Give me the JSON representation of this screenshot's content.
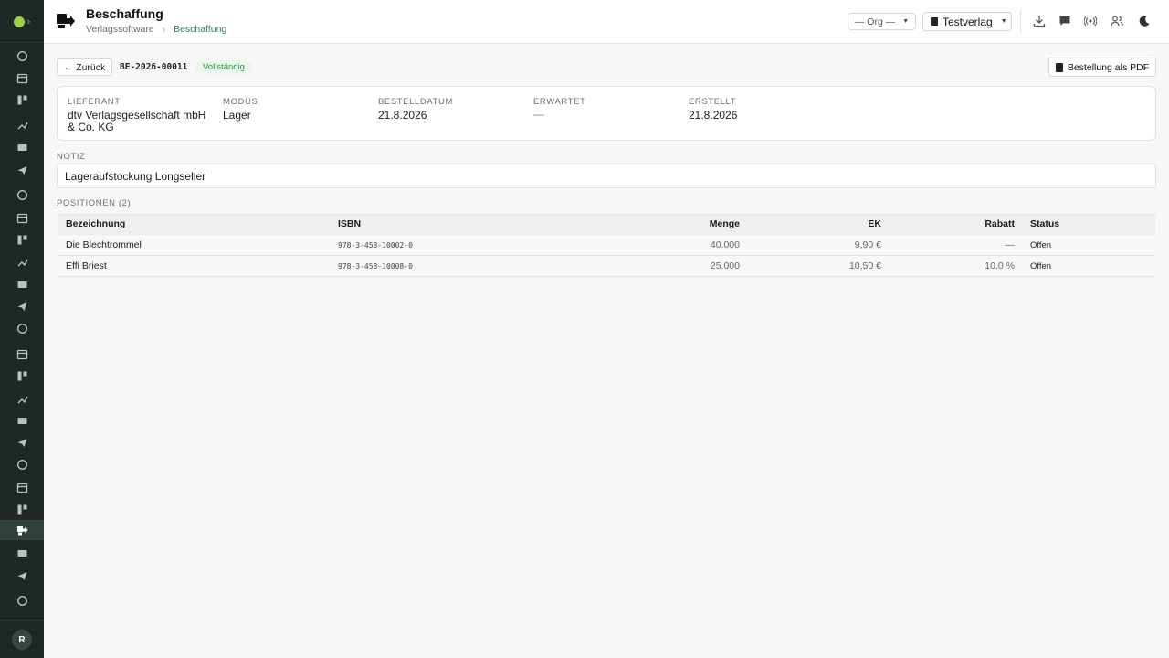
{
  "sidebar": {
    "items": [
      {
        "icon": "dashboard-icon"
      },
      {
        "icon": "calendar-icon"
      },
      {
        "icon": "kanban-icon"
      },
      {
        "icon": "authors-icon"
      },
      {
        "icon": "books-icon"
      },
      {
        "icon": "send-icon"
      },
      {
        "icon": "lightbulb-icon"
      },
      {
        "icon": "library-icon"
      },
      {
        "icon": "image-icon"
      },
      {
        "icon": "briefcase-icon"
      },
      {
        "icon": "newspaper-icon"
      },
      {
        "icon": "scroll-icon"
      },
      {
        "icon": "feather-icon"
      },
      {
        "icon": "truck-icon"
      },
      {
        "icon": "circle-icon"
      },
      {
        "icon": "shopping-bag-icon"
      },
      {
        "icon": "megaphone-icon"
      },
      {
        "icon": "video-icon"
      },
      {
        "icon": "music-icon"
      },
      {
        "icon": "file-icon"
      },
      {
        "icon": "store-icon"
      },
      {
        "icon": "procurement-icon",
        "active": true
      },
      {
        "icon": "chart-icon"
      },
      {
        "icon": "clipboard-icon"
      },
      {
        "icon": "shield-icon"
      }
    ],
    "avatar_initial": "R"
  },
  "header": {
    "title": "Beschaffung",
    "breadcrumb_root": "Verlagssoftware",
    "breadcrumb_current": "Beschaffung",
    "org_select": "— Org —",
    "verlag_select": "Testverlag"
  },
  "order": {
    "back_label": "← Zurück",
    "id": "BE-2026-00011",
    "status": "Vollständig",
    "pdf_label": "Bestellung als PDF"
  },
  "info": {
    "lieferant_label": "LIEFERANT",
    "lieferant_value": "dtv Verlagsgesellschaft mbH & Co. KG",
    "modus_label": "MODUS",
    "modus_value": "Lager",
    "bestelldatum_label": "BESTELLDATUM",
    "bestelldatum_value": "21.8.2026",
    "erwartet_label": "ERWARTET",
    "erwartet_value": "—",
    "erstellt_label": "ERSTELLT",
    "erstellt_value": "21.8.2026"
  },
  "note": {
    "label": "NOTIZ",
    "value": "Lageraufstockung Longseller"
  },
  "positions": {
    "label": "POSITIONEN (2)",
    "columns": [
      "Bezeichnung",
      "ISBN",
      "Menge",
      "EK",
      "Rabatt",
      "Status"
    ],
    "rows": [
      {
        "name": "Die Blechtrommel",
        "isbn": "978-3-458-10002-0",
        "menge": "40.000",
        "ek": "9,90 €",
        "rabatt": "—",
        "status": "Offen"
      },
      {
        "name": "Effi Briest",
        "isbn": "978-3-458-10008-0",
        "menge": "25.000",
        "ek": "10,50 €",
        "rabatt": "10.0 %",
        "status": "Offen"
      }
    ]
  },
  "colors": {
    "sidebar_bg": "#1f2826",
    "accent": "#2f7a56",
    "badge_bg": "#e9f6ec",
    "badge_text": "#2e8b4e"
  }
}
